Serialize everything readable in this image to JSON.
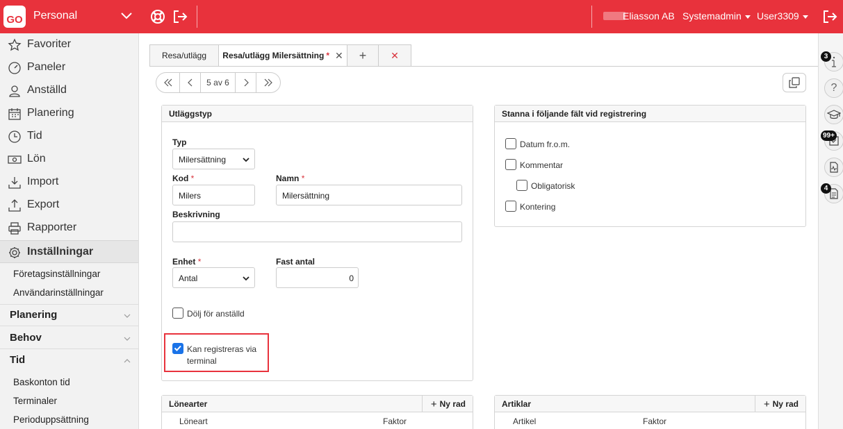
{
  "topbar": {
    "logo": "GO",
    "app_title": "Personal",
    "company": "Eliasson AB",
    "role": "Systemadmin",
    "user": "User3309"
  },
  "sidebar": {
    "items": [
      {
        "label": "Favoriter",
        "icon": "star-icon"
      },
      {
        "label": "Paneler",
        "icon": "gauge-icon"
      },
      {
        "label": "Anställd",
        "icon": "person-icon"
      },
      {
        "label": "Planering",
        "icon": "calendar-icon"
      },
      {
        "label": "Tid",
        "icon": "clock-icon"
      },
      {
        "label": "Lön",
        "icon": "money-icon"
      },
      {
        "label": "Import",
        "icon": "import-icon"
      },
      {
        "label": "Export",
        "icon": "export-icon"
      },
      {
        "label": "Rapporter",
        "icon": "printer-icon"
      }
    ],
    "active": {
      "label": "Inställningar",
      "icon": "gear-icon"
    },
    "sub_top": [
      "Företagsinställningar",
      "Användarinställningar"
    ],
    "sections": [
      {
        "label": "Planering",
        "expanded": false
      },
      {
        "label": "Behov",
        "expanded": false
      },
      {
        "label": "Tid",
        "expanded": true
      }
    ],
    "tid_items": [
      "Baskonton tid",
      "Terminaler",
      "Perioduppsättning"
    ]
  },
  "tabs": {
    "tab1": "Resa/utlägg",
    "tab2": "Resa/utlägg Milersättning",
    "tab2_required": "*"
  },
  "pager": {
    "label": "5 av 6"
  },
  "utlaggstyp": {
    "title": "Utläggstyp",
    "typ_label": "Typ",
    "typ_value": "Milersättning",
    "kod_label": "Kod",
    "kod_value": "Milers",
    "namn_label": "Namn",
    "namn_value": "Milersättning",
    "beskrivning_label": "Beskrivning",
    "beskrivning_value": "",
    "enhet_label": "Enhet",
    "enhet_value": "Antal",
    "fast_antal_label": "Fast antal",
    "fast_antal_value": "0",
    "req": "*",
    "dolj_label": "Dölj för anställd",
    "dolj_checked": false,
    "terminal_label_1": "Kan registreras via",
    "terminal_label_2": "terminal",
    "terminal_checked": true
  },
  "stanna": {
    "title": "Stanna i följande fält vid registrering",
    "options": [
      {
        "label": "Datum fr.o.m.",
        "checked": false
      },
      {
        "label": "Kommentar",
        "checked": false
      },
      {
        "label": "Obligatorisk",
        "checked": false
      },
      {
        "label": "Kontering",
        "checked": false
      }
    ]
  },
  "lonearter": {
    "title": "Lönearter",
    "add": "Ny rad",
    "col1": "Löneart",
    "col2": "Faktor"
  },
  "artiklar": {
    "title": "Artiklar",
    "add": "Ny rad",
    "col1": "Artikel",
    "col2": "Faktor"
  },
  "rail": {
    "info_badge": "3",
    "tasks_badge": "99+",
    "docs_badge": "4"
  },
  "colors": {
    "brand": "#e8323c",
    "check": "#1a73e8"
  }
}
